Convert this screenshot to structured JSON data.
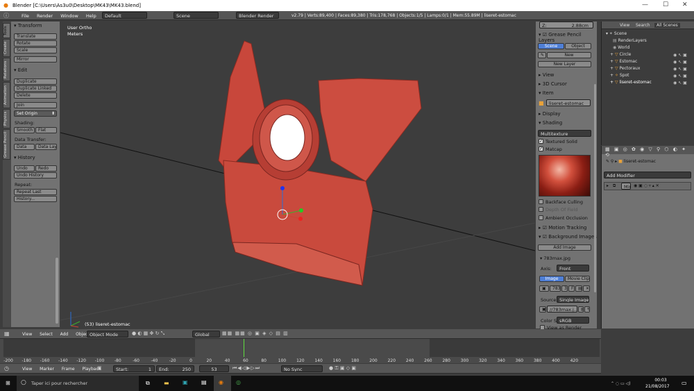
{
  "titlebar": {
    "title": "Blender [C:\\Users\\As3u0\\Desktop\\MK43\\MK43.blend]"
  },
  "topbar": {
    "menus": [
      "File",
      "Render",
      "Window",
      "Help"
    ],
    "layout": "Default",
    "scene": "Scene",
    "engine": "Blender Render",
    "stats": "v2.79 | Verts:89,400 | Faces:89,380 | Tris:178,768 | Objects:1/5 | Lamps:0/1 | Mem:55.89M | liseret-estomac"
  },
  "toolshelf": {
    "tabs": [
      "Tools",
      "Create",
      "Relations",
      "Animation",
      "Physics",
      "Grease Pencil"
    ],
    "transform_title": "Transform",
    "translate": "Translate",
    "rotate": "Rotate",
    "scale": "Scale",
    "mirror": "Mirror",
    "edit_title": "Edit",
    "duplicate": "Duplicate",
    "duplicate_linked": "Duplicate Linked",
    "delete": "Delete",
    "join": "Join",
    "set_origin": "Set Origin",
    "shading_label": "Shading:",
    "smooth": "Smooth",
    "flat": "Flat",
    "data_transfer_label": "Data Transfer:",
    "data": "Data",
    "data_layo": "Data Layo",
    "history_title": "History",
    "undo": "Undo",
    "redo": "Redo",
    "undo_history": "Undo History",
    "repeat_label": "Repeat:",
    "repeat_last": "Repeat Last",
    "history_btn": "History..."
  },
  "viewport": {
    "view_name": "User Ortho",
    "units": "Meters",
    "object_info": "(53) liseret-estomac"
  },
  "properties_panel": {
    "z_value": "Z:",
    "z_amount": "2.88cm",
    "grease_pencil": "Grease Pencil Layers",
    "scene_btn": "Scene",
    "object_btn": "Object",
    "new_btn": "New",
    "new_layer": "New Layer",
    "view": "View",
    "cursor_3d": "3D Cursor",
    "item": "Item",
    "item_name": "liseret-estomac",
    "display": "Display",
    "shading": "Shading",
    "multitexture": "Multitexture",
    "textured_solid": "Textured Solid",
    "matcap": "Matcap",
    "backface_culling": "Backface Culling",
    "depth_of_field": "Depth Of Field",
    "ambient_occlusion": "Ambient Occlusion",
    "motion_tracking": "Motion Tracking",
    "background_images": "Background Images",
    "add_image": "Add Image",
    "image_file": "783max.jpg",
    "axis_label": "Axis:",
    "axis_value": "Front",
    "image_tab": "Image",
    "movie_clip_tab": "Movie Clip",
    "image_num": "783",
    "image_users": "3",
    "image_f": "F",
    "source_label": "Source:",
    "source_value": "Single Image",
    "path_value": "//783max.j...",
    "color_s_label": "Color S",
    "color_s_value": "sRGB",
    "view_as_render": "View as Render"
  },
  "outliner": {
    "header_view": "View",
    "header_search": "Search",
    "header_scenes": "All Scenes",
    "items": [
      {
        "label": "Scene"
      },
      {
        "label": "RenderLayers"
      },
      {
        "label": "World"
      },
      {
        "label": "Circle"
      },
      {
        "label": "Estomac"
      },
      {
        "label": "Pectoraux"
      },
      {
        "label": "Spot"
      },
      {
        "label": "liseret-estomac"
      }
    ]
  },
  "modifiers": {
    "object_name": "liseret-estomac",
    "add_modifier": "Add Modifier",
    "mirror": "Mir"
  },
  "view3d_header": {
    "menus": [
      "View",
      "Select",
      "Add",
      "Object"
    ],
    "mode": "Object Mode",
    "orientation": "Global"
  },
  "timeline": {
    "ticks": [
      "-200",
      "-180",
      "-160",
      "-140",
      "-120",
      "-100",
      "-80",
      "-60",
      "-40",
      "-20",
      "0",
      "20",
      "40",
      "60",
      "80",
      "100",
      "120",
      "140",
      "160",
      "180",
      "200",
      "220",
      "240",
      "260",
      "280",
      "300",
      "320",
      "340",
      "360",
      "380",
      "400",
      "420"
    ],
    "menus": [
      "View",
      "Marker",
      "Frame",
      "Playback"
    ],
    "start_label": "Start:",
    "start_value": "1",
    "end_label": "End:",
    "end_value": "250",
    "current_frame": "53",
    "sync": "No Sync"
  },
  "taskbar": {
    "search_placeholder": "Taper ici pour rechercher",
    "time": "00:03",
    "date": "21/08/2017"
  }
}
